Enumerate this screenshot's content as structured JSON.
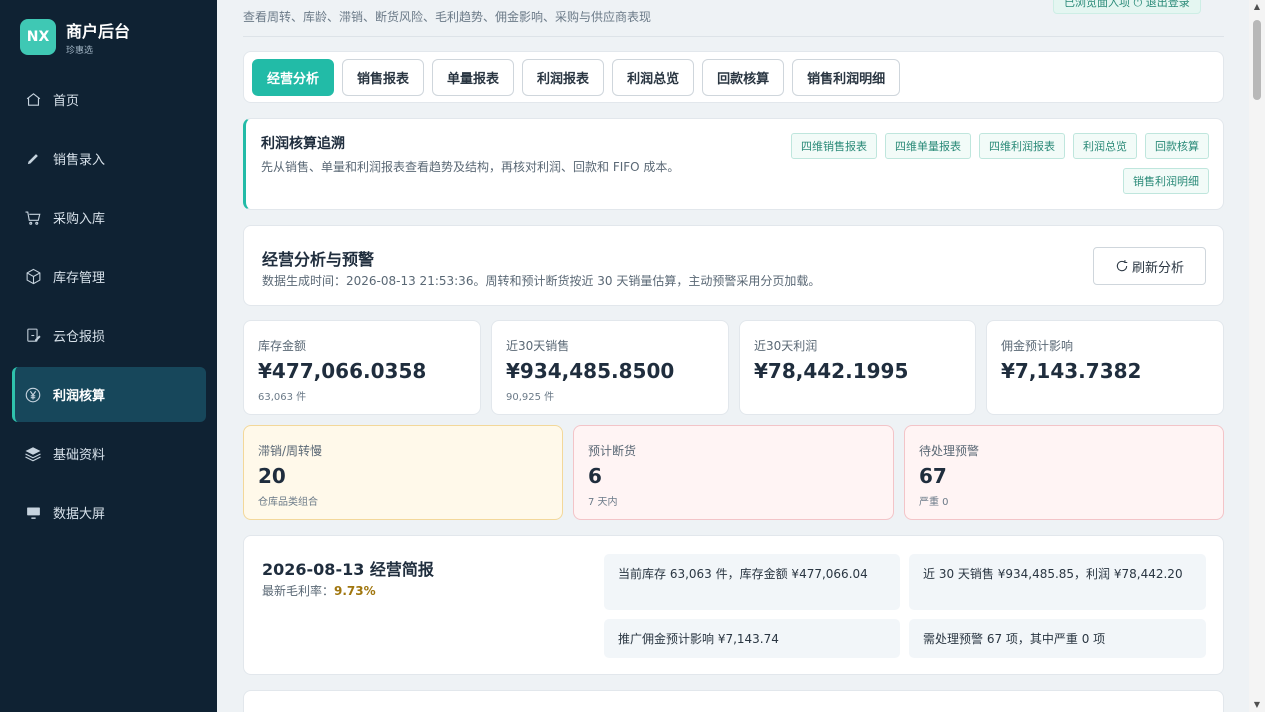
{
  "brand": {
    "logo": "NX",
    "title": "商户后台",
    "subtitle": "珍惠选"
  },
  "nav": [
    {
      "label": "首页",
      "icon": "home-icon"
    },
    {
      "label": "销售录入",
      "icon": "pencil-icon"
    },
    {
      "label": "采购入库",
      "icon": "cart-icon"
    },
    {
      "label": "库存管理",
      "icon": "box-icon"
    },
    {
      "label": "云仓报损",
      "icon": "report-icon"
    },
    {
      "label": "利润核算",
      "icon": "yen-icon",
      "active": true
    },
    {
      "label": "基础资料",
      "icon": "layers-icon"
    },
    {
      "label": "数据大屏",
      "icon": "screen-icon"
    }
  ],
  "header": {
    "description": "查看周转、库龄、滞销、断货风险、毛利趋势、佣金影响、采购与供应商表现",
    "top_right": "已浏览面入项  ⏻ 退出登录"
  },
  "tabs": [
    "经营分析",
    "销售报表",
    "单量报表",
    "利润报表",
    "利润总览",
    "回款核算",
    "销售利润明细"
  ],
  "trace": {
    "title": "利润核算追溯",
    "desc": "先从销售、单量和利润报表查看趋势及结构，再核对利润、回款和 FIFO 成本。",
    "chips": [
      "四维销售报表",
      "四维单量报表",
      "四维利润报表",
      "利润总览",
      "回款核算",
      "销售利润明细"
    ]
  },
  "analysis": {
    "title": "经营分析与预警",
    "subtitle": "数据生成时间：2026-08-13 21:53:36。周转和预计断货按近 30 天销量估算，主动预警采用分页加载。",
    "refresh": "刷新分析"
  },
  "stats": [
    {
      "label": "库存金额",
      "value": "¥477,066.0358",
      "sub": "63,063 件"
    },
    {
      "label": "近30天销售",
      "value": "¥934,485.8500",
      "sub": "90,925 件"
    },
    {
      "label": "近30天利润",
      "value": "¥78,442.1995",
      "sub": ""
    },
    {
      "label": "佣金预计影响",
      "value": "¥7,143.7382",
      "sub": ""
    }
  ],
  "warnings": [
    {
      "label": "滞销/周转慢",
      "value": "20",
      "sub": "仓库品类组合"
    },
    {
      "label": "预计断货",
      "value": "6",
      "sub": "7 天内"
    },
    {
      "label": "待处理预警",
      "value": "67",
      "sub": "严重 0"
    }
  ],
  "brief": {
    "title": "2026-08-13 经营简报",
    "margin_label": "最新毛利率：",
    "margin_value": "9.73%",
    "cells": [
      "当前库存 63,063 件，库存金额 ¥477,066.04",
      "近 30 天销售 ¥934,485.85，利润 ¥78,442.20",
      "推广佣金预计影响 ¥7,143.74",
      "需处理预警 67 项，其中严重 0 项"
    ]
  },
  "colors": {
    "accent": "#22bba7",
    "sidebar": "#0f2233"
  }
}
